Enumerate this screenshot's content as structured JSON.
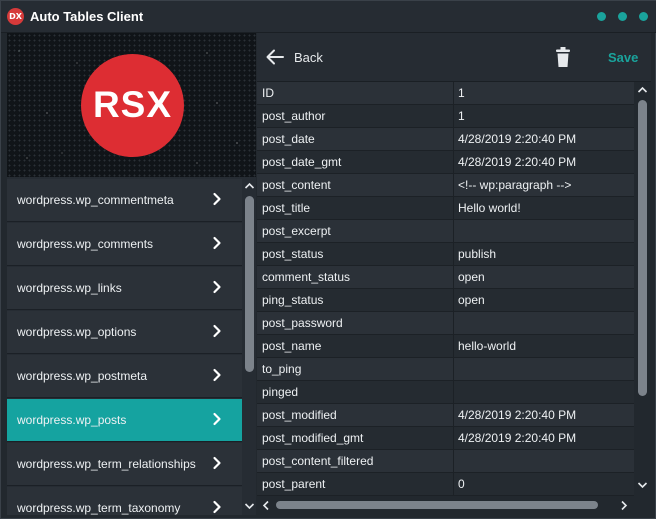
{
  "window": {
    "app_icon_text": "DX",
    "title": "Auto Tables Client",
    "accent_color": "#1aa39c"
  },
  "hero": {
    "logo_text": "RSX",
    "logo_color": "#dd2d33"
  },
  "sidebar": {
    "items": [
      {
        "label": "wordpress.wp_commentmeta",
        "active": false
      },
      {
        "label": "wordpress.wp_comments",
        "active": false
      },
      {
        "label": "wordpress.wp_links",
        "active": false
      },
      {
        "label": "wordpress.wp_options",
        "active": false
      },
      {
        "label": "wordpress.wp_postmeta",
        "active": false
      },
      {
        "label": "wordpress.wp_posts",
        "active": true
      },
      {
        "label": "wordpress.wp_term_relationships",
        "active": false
      },
      {
        "label": "wordpress.wp_term_taxonomy",
        "active": false
      }
    ],
    "item_icon": "chevron-right-icon"
  },
  "toolbar": {
    "back_icon": "arrow-left-icon",
    "back_label": "Back",
    "delete_icon": "trash-icon",
    "save_label": "Save"
  },
  "record": {
    "rows": [
      {
        "key": "ID",
        "value": "1"
      },
      {
        "key": "post_author",
        "value": "1"
      },
      {
        "key": "post_date",
        "value": "4/28/2019 2:20:40 PM"
      },
      {
        "key": "post_date_gmt",
        "value": "4/28/2019 2:20:40 PM"
      },
      {
        "key": "post_content",
        "value": "<!-- wp:paragraph -->"
      },
      {
        "key": "post_title",
        "value": "Hello world!"
      },
      {
        "key": "post_excerpt",
        "value": ""
      },
      {
        "key": "post_status",
        "value": "publish"
      },
      {
        "key": "comment_status",
        "value": "open"
      },
      {
        "key": "ping_status",
        "value": "open"
      },
      {
        "key": "post_password",
        "value": ""
      },
      {
        "key": "post_name",
        "value": "hello-world"
      },
      {
        "key": "to_ping",
        "value": ""
      },
      {
        "key": "pinged",
        "value": ""
      },
      {
        "key": "post_modified",
        "value": "4/28/2019 2:20:40 PM"
      },
      {
        "key": "post_modified_gmt",
        "value": "4/28/2019 2:20:40 PM"
      },
      {
        "key": "post_content_filtered",
        "value": ""
      },
      {
        "key": "post_parent",
        "value": "0"
      }
    ]
  }
}
